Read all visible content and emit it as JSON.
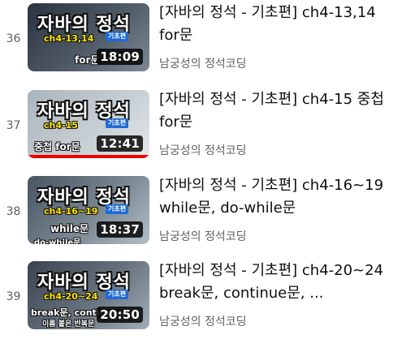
{
  "playlist": {
    "items": [
      {
        "index": "36",
        "title": "[자바의 정석 - 기초편] ch4-13,14 for문",
        "channel": "남궁성의 정석코딩",
        "duration": "18:09",
        "thumb": {
          "headline": "자바의 정석",
          "chapter": "ch4-13,14",
          "badge": "기초편",
          "topic": "for문"
        }
      },
      {
        "index": "37",
        "title": "[자바의 정석 - 기초편] ch4-15 중첩 for문",
        "channel": "남궁성의 정석코딩",
        "duration": "12:41",
        "watched": 1.0,
        "thumb": {
          "headline": "자바의 정석",
          "chapter": "ch4-15",
          "badge": "기초편",
          "topic": "중첩 for문"
        }
      },
      {
        "index": "38",
        "title": "[자바의 정석 - 기초편] ch4-16~19 while문, do-while문",
        "channel": "남궁성의 정석코딩",
        "duration": "18:37",
        "thumb": {
          "headline": "자바의 정석",
          "chapter": "ch4-16~19",
          "badge": "기초편",
          "topic": "while문",
          "topic2": "do-while문"
        }
      },
      {
        "index": "39",
        "title": "[자바의 정석 - 기초편] ch4-20~24 break문, continue문, ...",
        "channel": "남궁성의 정석코딩",
        "duration": "20:50",
        "thumb": {
          "headline": "자바의 정석",
          "chapter": "ch4-20~24",
          "badge": "기초편",
          "topic": "break문, continue문",
          "topic2": "이름 붙은 반복문"
        }
      }
    ]
  },
  "colors": {
    "progress": "#ee0000",
    "badge": "#1f6ad6",
    "chapter_text": "#ffe600"
  }
}
